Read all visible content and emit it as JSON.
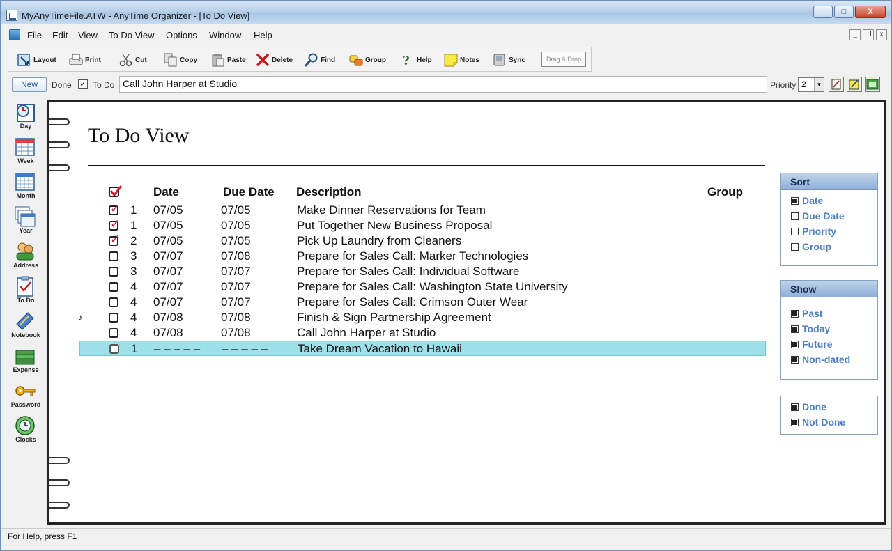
{
  "window": {
    "title": "MyAnyTimeFile.ATW - AnyTime Organizer - [To Do View]",
    "controls": [
      "_",
      "□",
      "X"
    ]
  },
  "menu": [
    "File",
    "Edit",
    "View",
    "To Do View",
    "Options",
    "Window",
    "Help"
  ],
  "mdi_controls": [
    "_",
    "❐",
    "x"
  ],
  "toolbar": {
    "layout": "Layout",
    "print": "Print",
    "cut": "Cut",
    "copy": "Copy",
    "paste": "Paste",
    "delete": "Delete",
    "find": "Find",
    "group": "Group",
    "help": "Help",
    "notes": "Notes",
    "sync": "Sync",
    "drag_drop": "Drag & Drop"
  },
  "entry": {
    "new_label": "New",
    "done_label": "Done",
    "done_checked": "✓",
    "todo_label": "To Do",
    "value": "Call John Harper at Studio",
    "priority_label": "Priority",
    "priority_value": "2"
  },
  "nav": [
    {
      "label": "Day",
      "icon": "day-calendar-icon"
    },
    {
      "label": "Week",
      "icon": "week-calendar-icon"
    },
    {
      "label": "Month",
      "icon": "month-calendar-icon"
    },
    {
      "label": "Year",
      "icon": "year-calendar-icon"
    },
    {
      "label": "Address",
      "icon": "address-book-icon"
    },
    {
      "label": "To Do",
      "icon": "todo-clipboard-icon"
    },
    {
      "label": "Notebook",
      "icon": "notebook-icon"
    },
    {
      "label": "Expense",
      "icon": "expense-money-icon"
    },
    {
      "label": "Password",
      "icon": "password-key-icon"
    },
    {
      "label": "Clocks",
      "icon": "clocks-globe-icon"
    }
  ],
  "page": {
    "title": "To Do View",
    "columns": {
      "date": "Date",
      "due_date": "Due Date",
      "description": "Description",
      "group": "Group"
    },
    "rows": [
      {
        "done": true,
        "priority": "1",
        "date": "07/05",
        "due": "07/05",
        "description": "Make Dinner Reservations for Team",
        "note": ""
      },
      {
        "done": true,
        "priority": "1",
        "date": "07/05",
        "due": "07/05",
        "description": "Put Together New Business Proposal",
        "note": ""
      },
      {
        "done": true,
        "priority": "2",
        "date": "07/05",
        "due": "07/05",
        "description": "Pick Up Laundry from Cleaners",
        "note": ""
      },
      {
        "done": false,
        "priority": "3",
        "date": "07/07",
        "due": "07/08",
        "description": "Prepare for Sales Call: Marker Technologies",
        "note": ""
      },
      {
        "done": false,
        "priority": "3",
        "date": "07/07",
        "due": "07/07",
        "description": "Prepare for Sales Call: Individual Software",
        "note": ""
      },
      {
        "done": false,
        "priority": "4",
        "date": "07/07",
        "due": "07/07",
        "description": "Prepare for Sales Call: Washington State University",
        "note": ""
      },
      {
        "done": false,
        "priority": "4",
        "date": "07/07",
        "due": "07/07",
        "description": "Prepare for Sales Call: Crimson Outer Wear",
        "note": ""
      },
      {
        "done": false,
        "priority": "4",
        "date": "07/08",
        "due": "07/08",
        "description": "Finish & Sign Partnership Agreement",
        "note": "♪"
      },
      {
        "done": false,
        "priority": "4",
        "date": "07/08",
        "due": "07/08",
        "description": "Call John Harper at Studio",
        "note": ""
      },
      {
        "done": false,
        "priority": "1",
        "date": "– – – – –",
        "due": "– – – – –",
        "description": "Take Dream Vacation to Hawaii",
        "note": "",
        "selected": true
      }
    ]
  },
  "sort_panel": {
    "title": "Sort",
    "options": [
      {
        "label": "Date",
        "on": true
      },
      {
        "label": "Due Date",
        "on": false
      },
      {
        "label": "Priority",
        "on": false
      },
      {
        "label": "Group",
        "on": false
      }
    ]
  },
  "show_panel": {
    "title": "Show",
    "options": [
      {
        "label": "Past",
        "on": true
      },
      {
        "label": "Today",
        "on": true
      },
      {
        "label": "Future",
        "on": true
      },
      {
        "label": "Non-dated",
        "on": true
      }
    ]
  },
  "done_panel": {
    "options": [
      {
        "label": "Done",
        "on": true
      },
      {
        "label": "Not Done",
        "on": true
      }
    ]
  },
  "status": "For Help, press F1",
  "colors": {
    "selected_row": "#9ee0ea",
    "check_red": "#c41c2c",
    "option_blue": "#4c7fbf"
  }
}
